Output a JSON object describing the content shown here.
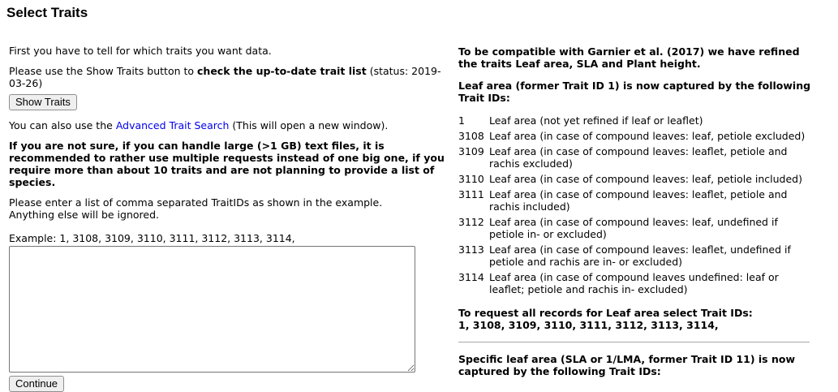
{
  "title": "Select Traits",
  "left": {
    "intro": "First you have to tell for which traits you want data.",
    "show_traits_pre": "Please use the Show Traits button to ",
    "show_traits_bold": "check the up-to-date trait list",
    "show_traits_post": " (status: 2019-03-26)",
    "show_traits_button": "Show Traits",
    "advanced_pre": "You can also use the ",
    "advanced_link": "Advanced Trait Search",
    "advanced_post": " (This will open a new window).",
    "warning": "If you are not sure, if you can handle large (>1 GB) text files, it is recommended to rather use multiple requests instead of one big one, if you require more than about 10 traits and are not planning to provide a list of species.",
    "instruction_line1": "Please enter a list of comma separated TraitIDs as shown in the example.",
    "instruction_line2": "Anything else will be ignored.",
    "example": "Example: 1, 3108, 3109, 3110, 3111, 3112, 3113, 3114,",
    "textarea_value": "",
    "continue_button": "Continue"
  },
  "right": {
    "compat": "To be compatible with Garnier et al. (2017) we have refined the traits Leaf area, SLA and Plant height.",
    "leaf_area_heading": "Leaf area (former Trait ID 1) is now captured by the following Trait IDs:",
    "traits": [
      {
        "id": "1",
        "desc": "Leaf area (not yet refined if leaf or leaflet)"
      },
      {
        "id": "3108",
        "desc": "Leaf area (in case of compound leaves: leaf, petiole excluded)"
      },
      {
        "id": "3109",
        "desc": "Leaf area (in case of compound leaves: leaflet, petiole and rachis excluded)"
      },
      {
        "id": "3110",
        "desc": "Leaf area (in case of compound leaves: leaf, petiole included)"
      },
      {
        "id": "3111",
        "desc": "Leaf area (in case of compound leaves: leaflet, petiole and rachis included)"
      },
      {
        "id": "3112",
        "desc": "Leaf area (in case of compound leaves: leaf, undefined if petiole in- or excluded)"
      },
      {
        "id": "3113",
        "desc": "Leaf area (in case of compound leaves: leaflet, undefined if petiole and rachis are in- or excluded)"
      },
      {
        "id": "3114",
        "desc": "Leaf area (in case of compound leaves undefined: leaf or leaflet; petiole and rachis in- excluded)"
      }
    ],
    "request_line1": "To request all records for Leaf area select Trait IDs:",
    "request_line2": "1, 3108, 3109, 3110, 3111, 3112, 3113, 3114,",
    "sla_heading": "Specific leaf area (SLA or 1/LMA, former Trait ID 11) is now captured by the following Trait IDs:"
  },
  "colors": {
    "link": "#0000ee",
    "divider": "#a8a8a8"
  }
}
